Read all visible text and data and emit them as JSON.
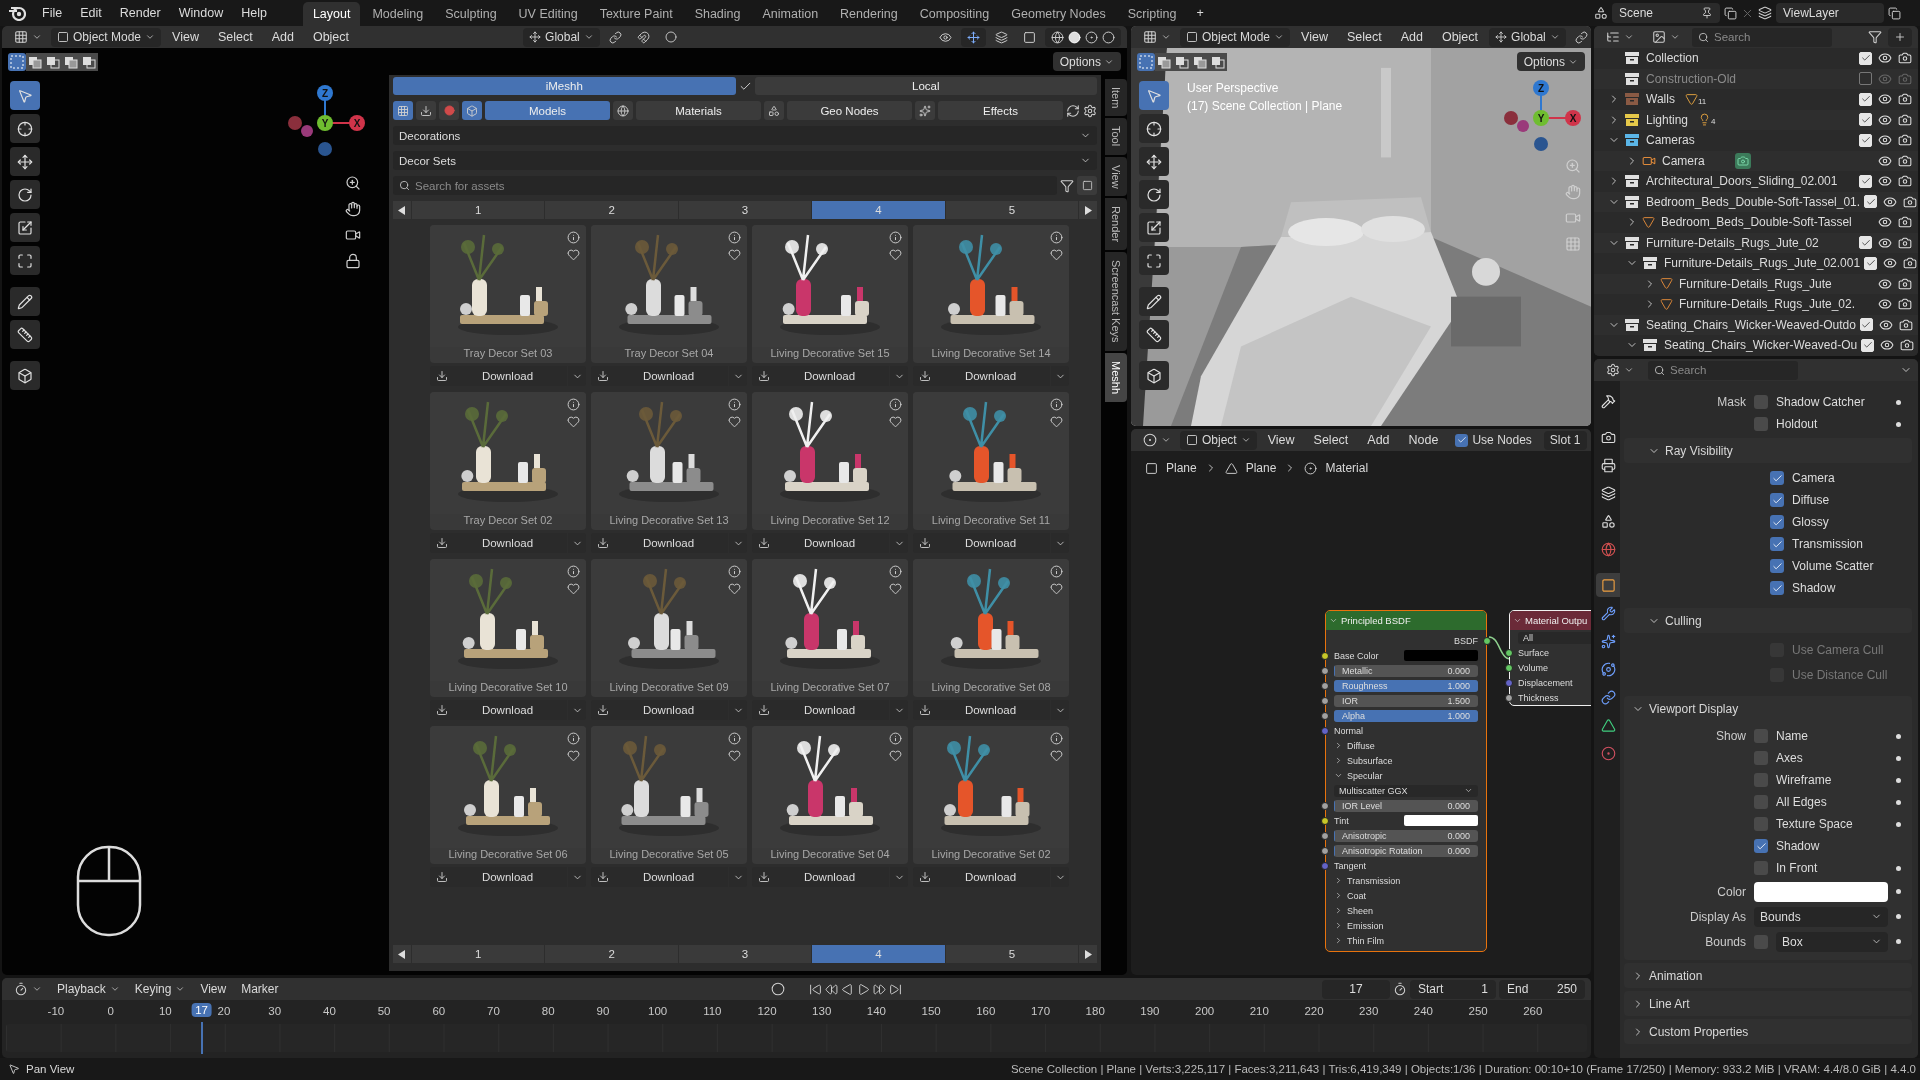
{
  "topbar": {
    "menus": [
      "File",
      "Edit",
      "Render",
      "Window",
      "Help"
    ],
    "workspaces": [
      {
        "label": "Layout",
        "selected": true
      },
      {
        "label": "Modeling",
        "selected": false
      },
      {
        "label": "Sculpting",
        "selected": false
      },
      {
        "label": "UV Editing",
        "selected": false
      },
      {
        "label": "Texture Paint",
        "selected": false
      },
      {
        "label": "Shading",
        "selected": false
      },
      {
        "label": "Animation",
        "selected": false
      },
      {
        "label": "Rendering",
        "selected": false
      },
      {
        "label": "Compositing",
        "selected": false
      },
      {
        "label": "Geometry Nodes",
        "selected": false
      },
      {
        "label": "Scripting",
        "selected": false
      }
    ],
    "add_workspace": "+"
  },
  "scene": {
    "name": "Scene",
    "view_layer": "ViewLayer"
  },
  "viewport": {
    "mode": "Object Mode",
    "menus": [
      "View",
      "Select",
      "Add",
      "Object"
    ],
    "orientation": "Global",
    "options": "Options",
    "axes": [
      "Z",
      "Y",
      "X"
    ],
    "tools": [
      {
        "selected": true
      },
      {
        "selected": false
      },
      {
        "selected": false
      },
      {
        "selected": false
      },
      {
        "selected": false
      },
      {
        "selected": false
      },
      {
        "selected": false
      },
      {
        "selected": false
      },
      {
        "selected": false
      }
    ]
  },
  "asset_browser": {
    "sources": [
      {
        "label": "iMeshh",
        "selected": true
      },
      {
        "label": "Local",
        "selected": false
      }
    ],
    "categories": [
      {
        "label": "Models",
        "selected": true
      },
      {
        "label": "Materials",
        "selected": false
      },
      {
        "label": "Geo Nodes",
        "selected": false
      },
      {
        "label": "Effects",
        "selected": false
      }
    ],
    "category": "Decorations",
    "subcategory": "Decor Sets",
    "search": {
      "placeholder": "Search for assets"
    },
    "pages_top": [
      {
        "label": "1",
        "selected": false
      },
      {
        "label": "2",
        "selected": false
      },
      {
        "label": "3",
        "selected": false
      },
      {
        "label": "4",
        "selected": true
      },
      {
        "label": "5",
        "selected": false
      }
    ],
    "assets": [
      {
        "name": "Tray Decor Set 03",
        "action": "Download"
      },
      {
        "name": "Tray Decor Set 04",
        "action": "Download"
      },
      {
        "name": "Living Decorative Set 15",
        "action": "Download"
      },
      {
        "name": "Living Decorative Set 14",
        "action": "Download"
      },
      {
        "name": "Tray Decor Set 02",
        "action": "Download"
      },
      {
        "name": "Living Decorative Set 13",
        "action": "Download"
      },
      {
        "name": "Living Decorative Set 12",
        "action": "Download"
      },
      {
        "name": "Living Decorative Set 11",
        "action": "Download"
      },
      {
        "name": "Living Decorative Set 10",
        "action": "Download"
      },
      {
        "name": "Living Decorative Set 09",
        "action": "Download"
      },
      {
        "name": "Living Decorative Set 07",
        "action": "Download"
      },
      {
        "name": "Living Decorative Set 08",
        "action": "Download"
      },
      {
        "name": "Living Decorative Set 06",
        "action": "Download"
      },
      {
        "name": "Living Decorative Set 05",
        "action": "Download"
      },
      {
        "name": "Living Decorative Set 04",
        "action": "Download"
      },
      {
        "name": "Living Decorative Set 02",
        "action": "Download"
      }
    ],
    "pages_bottom": [
      {
        "label": "1",
        "selected": false
      },
      {
        "label": "2",
        "selected": false
      },
      {
        "label": "3",
        "selected": false
      },
      {
        "label": "4",
        "selected": true
      },
      {
        "label": "5",
        "selected": false
      }
    ]
  },
  "sidebar_tabs": [
    {
      "label": "Item",
      "selected": false
    },
    {
      "label": "Tool",
      "selected": false
    },
    {
      "label": "View",
      "selected": false
    },
    {
      "label": "Render",
      "selected": false
    },
    {
      "label": "Screencast Keys",
      "selected": false
    },
    {
      "label": "Meshh",
      "selected": true
    }
  ],
  "camera_view": {
    "mode": "Object Mode",
    "menus": [
      "View",
      "Select",
      "Add",
      "Object"
    ],
    "orientation": "Global",
    "options": "Options",
    "title": "User Perspective",
    "info": "(17) Scene Collection | Plane",
    "axes": [
      "Z",
      "Y",
      "X"
    ],
    "tools": [
      {
        "selected": true
      },
      {
        "selected": false
      },
      {
        "selected": false
      },
      {
        "selected": false
      },
      {
        "selected": false
      },
      {
        "selected": false
      },
      {
        "selected": false
      },
      {
        "selected": false
      },
      {
        "selected": false
      }
    ]
  },
  "node_editor": {
    "type": "Object",
    "menus": [
      "View",
      "Select",
      "Add",
      "Node"
    ],
    "use_nodes": {
      "label": "Use Nodes",
      "checked": true
    },
    "slot": "Slot 1",
    "breadcrumbs": [
      "Plane",
      "Plane",
      "Material"
    ],
    "bsdf_node": {
      "title": "Principled BSDF",
      "selected": true,
      "rows": [
        {
          "kind": "output",
          "label": "BSDF"
        },
        {
          "kind": "color",
          "label": "Base Color",
          "color": "#000000"
        },
        {
          "kind": "slider",
          "label": "Metallic",
          "value": "0.000",
          "level": 0
        },
        {
          "kind": "slider",
          "label": "Roughness",
          "value": "1.000",
          "level": 1
        },
        {
          "kind": "number",
          "label": "IOR",
          "value": "1.500"
        },
        {
          "kind": "slider",
          "label": "Alpha",
          "value": "1.000",
          "level": 1
        },
        {
          "kind": "socket",
          "label": "Normal"
        },
        {
          "kind": "panel",
          "label": "Diffuse",
          "expanded": false
        },
        {
          "kind": "panel",
          "label": "Subsurface",
          "expanded": false
        },
        {
          "kind": "panel",
          "label": "Specular",
          "expanded": true
        },
        {
          "kind": "dropdown",
          "label": "Multiscatter GGX"
        },
        {
          "kind": "slider",
          "label": "IOR Level",
          "value": "0.000",
          "level": 0
        },
        {
          "kind": "color",
          "label": "Tint",
          "color": "#ffffff"
        },
        {
          "kind": "slider",
          "label": "Anisotropic",
          "value": "0.000",
          "level": 0
        },
        {
          "kind": "slider",
          "label": "Anisotropic Rotation",
          "value": "0.000",
          "level": 0
        },
        {
          "kind": "socket",
          "label": "Tangent"
        },
        {
          "kind": "panel",
          "label": "Transmission",
          "expanded": false
        },
        {
          "kind": "panel",
          "label": "Coat",
          "expanded": false
        },
        {
          "kind": "panel",
          "label": "Sheen",
          "expanded": false
        },
        {
          "kind": "panel",
          "label": "Emission",
          "expanded": false
        },
        {
          "kind": "panel",
          "label": "Thin Film",
          "expanded": false
        }
      ]
    },
    "output_node": {
      "title": "Material Outpu",
      "active": true,
      "target": "All",
      "inputs": [
        {
          "label": "Surface",
          "color": "#63c763"
        },
        {
          "label": "Volume",
          "color": "#63c763"
        },
        {
          "label": "Displacement",
          "color": "#6363c7"
        },
        {
          "label": "Thickness",
          "color": "#a1a1a1"
        }
      ]
    }
  },
  "outliner": {
    "search": {
      "placeholder": "Search"
    },
    "items": [
      {
        "name": "Collection",
        "kind": "collection",
        "color": "#e0e0e0",
        "checked": true
      },
      {
        "name": "Construction-Old",
        "kind": "collection",
        "color": "#e0e0e0",
        "checked": false
      },
      {
        "name": "Walls",
        "kind": "collection",
        "color": "#8a5a44",
        "checked": true,
        "expanded": false,
        "badge": {
          "kind": "mesh",
          "count": "11"
        }
      },
      {
        "name": "Lighting",
        "kind": "collection",
        "color": "#e6c94a",
        "checked": true,
        "expanded": false,
        "badge": {
          "kind": "light",
          "count": "4"
        }
      },
      {
        "name": "Cameras",
        "kind": "collection",
        "color": "#5bb6e8",
        "checked": true,
        "expanded": true,
        "children": [
          {
            "name": "Camera",
            "kind": "camera",
            "expanded": false
          }
        ]
      },
      {
        "name": "Architectural_Doors_Sliding_02.001",
        "kind": "collection",
        "color": "#e0e0e0",
        "checked": true,
        "expanded": false
      },
      {
        "name": "Bedroom_Beds_Double-Soft-Tassel_01.",
        "kind": "collection",
        "color": "#e0e0e0",
        "checked": true,
        "expanded": true,
        "children": [
          {
            "name": "Bedroom_Beds_Double-Soft-Tassel",
            "kind": "mesh",
            "expanded": false
          }
        ]
      },
      {
        "name": "Furniture-Details_Rugs_Jute_02",
        "kind": "collection",
        "color": "#e0e0e0",
        "checked": true,
        "expanded": true,
        "children": [
          {
            "name": "Furniture-Details_Rugs_Jute_02.001",
            "kind": "collection",
            "color": "#e0e0e0",
            "checked": true,
            "expanded": true,
            "children": [
              {
                "name": "Furniture-Details_Rugs_Jute",
                "kind": "mesh",
                "expanded": false
              },
              {
                "name": "Furniture-Details_Rugs_Jute_02.",
                "kind": "mesh",
                "expanded": false
              }
            ]
          }
        ]
      },
      {
        "name": "Seating_Chairs_Wicker-Weaved-Outdo",
        "kind": "collection",
        "color": "#e0e0e0",
        "checked": true,
        "expanded": true,
        "children": [
          {
            "name": "Seating_Chairs_Wicker-Weaved-Ou",
            "kind": "collection",
            "color": "#e0e0e0",
            "checked": true,
            "expanded": true
          }
        ]
      }
    ]
  },
  "properties": {
    "search": {
      "placeholder": "Search"
    },
    "tabs": [
      {
        "kind": "tool",
        "selected": false
      },
      {
        "kind": "render",
        "selected": false
      },
      {
        "kind": "output",
        "selected": false
      },
      {
        "kind": "view_layer",
        "selected": false
      },
      {
        "kind": "scene",
        "selected": false
      },
      {
        "kind": "world",
        "selected": false
      },
      {
        "kind": "object",
        "selected": true
      },
      {
        "kind": "modifiers",
        "selected": false
      },
      {
        "kind": "particles",
        "selected": false
      },
      {
        "kind": "physics",
        "selected": false
      },
      {
        "kind": "constraints",
        "selected": false
      },
      {
        "kind": "data",
        "selected": false
      },
      {
        "kind": "material",
        "selected": false
      }
    ],
    "sections": [
      {
        "kind": "group",
        "rows": [
          {
            "kind": "check",
            "label": "Mask",
            "option": "Shadow Catcher",
            "checked": false,
            "keyframe": true
          },
          {
            "kind": "check",
            "option": "Holdout",
            "checked": false,
            "keyframe": true
          }
        ]
      },
      {
        "kind": "subpanel",
        "title": "Ray Visibility",
        "expanded": true,
        "rows": [
          {
            "kind": "check",
            "option": "Camera",
            "checked": true,
            "keyframe": false
          },
          {
            "kind": "check",
            "option": "Diffuse",
            "checked": true,
            "keyframe": false
          },
          {
            "kind": "check",
            "option": "Glossy",
            "checked": true,
            "keyframe": false
          },
          {
            "kind": "check",
            "option": "Transmission",
            "checked": true,
            "keyframe": false
          },
          {
            "kind": "check",
            "option": "Volume Scatter",
            "checked": true,
            "keyframe": false
          },
          {
            "kind": "check",
            "option": "Shadow",
            "checked": true,
            "keyframe": false
          }
        ]
      },
      {
        "kind": "subpanel",
        "title": "Culling",
        "expanded": true,
        "rows": [
          {
            "kind": "check",
            "option": "Use Camera Cull",
            "checked": false,
            "disabled": true,
            "keyframe": false
          },
          {
            "kind": "check",
            "option": "Use Distance Cull",
            "checked": false,
            "disabled": true,
            "keyframe": false
          }
        ]
      },
      {
        "kind": "panel",
        "title": "Viewport Display",
        "expanded": true,
        "rows": [
          {
            "kind": "check",
            "label": "Show",
            "option": "Name",
            "checked": false,
            "keyframe": true
          },
          {
            "kind": "check",
            "option": "Axes",
            "checked": false,
            "keyframe": true
          },
          {
            "kind": "check",
            "option": "Wireframe",
            "checked": false,
            "keyframe": true
          },
          {
            "kind": "check",
            "option": "All Edges",
            "checked": false,
            "keyframe": true
          },
          {
            "kind": "check",
            "option": "Texture Space",
            "checked": false,
            "keyframe": true
          },
          {
            "kind": "check",
            "option": "Shadow",
            "checked": true,
            "keyframe": false
          },
          {
            "kind": "check",
            "option": "In Front",
            "checked": false,
            "keyframe": true
          },
          {
            "kind": "color",
            "label": "Color",
            "color": "#ffffff",
            "keyframe": true
          },
          {
            "kind": "select",
            "label": "Display As",
            "value": "Bounds",
            "keyframe": true
          },
          {
            "kind": "check_select",
            "label": "Bounds",
            "checked": false,
            "value": "Box",
            "keyframe": true
          }
        ]
      },
      {
        "kind": "panel",
        "title": "Animation",
        "expanded": false
      },
      {
        "kind": "panel",
        "title": "Line Art",
        "expanded": false
      },
      {
        "kind": "panel",
        "title": "Custom Properties",
        "expanded": false
      }
    ]
  },
  "timeline": {
    "menus": [
      {
        "label": "Playback",
        "dropdown": true
      },
      {
        "label": "Keying",
        "dropdown": true
      },
      {
        "label": "View",
        "dropdown": false
      },
      {
        "label": "Marker",
        "dropdown": false
      }
    ],
    "frame": "17",
    "start_label": "Start",
    "start": "1",
    "end_label": "End",
    "end": "250",
    "current": "17",
    "ticks": [
      "-10",
      "0",
      "10",
      "20",
      "30",
      "40",
      "50",
      "60",
      "70",
      "80",
      "90",
      "100",
      "110",
      "120",
      "130",
      "140",
      "150",
      "160",
      "170",
      "180",
      "190",
      "200",
      "210",
      "220",
      "230",
      "240",
      "250",
      "260"
    ]
  },
  "status_bar": {
    "hint": "Pan View",
    "stats": "Scene Collection | Plane | Verts:3,225,117 | Faces:3,211,643 | Tris:6,419,349 | Objects:1/36 | Duration: 00:10+10 (Frame 17/250) | Memory: 933.2 MiB | VRAM: 4.4/8.0 GiB | 4.4.0"
  }
}
